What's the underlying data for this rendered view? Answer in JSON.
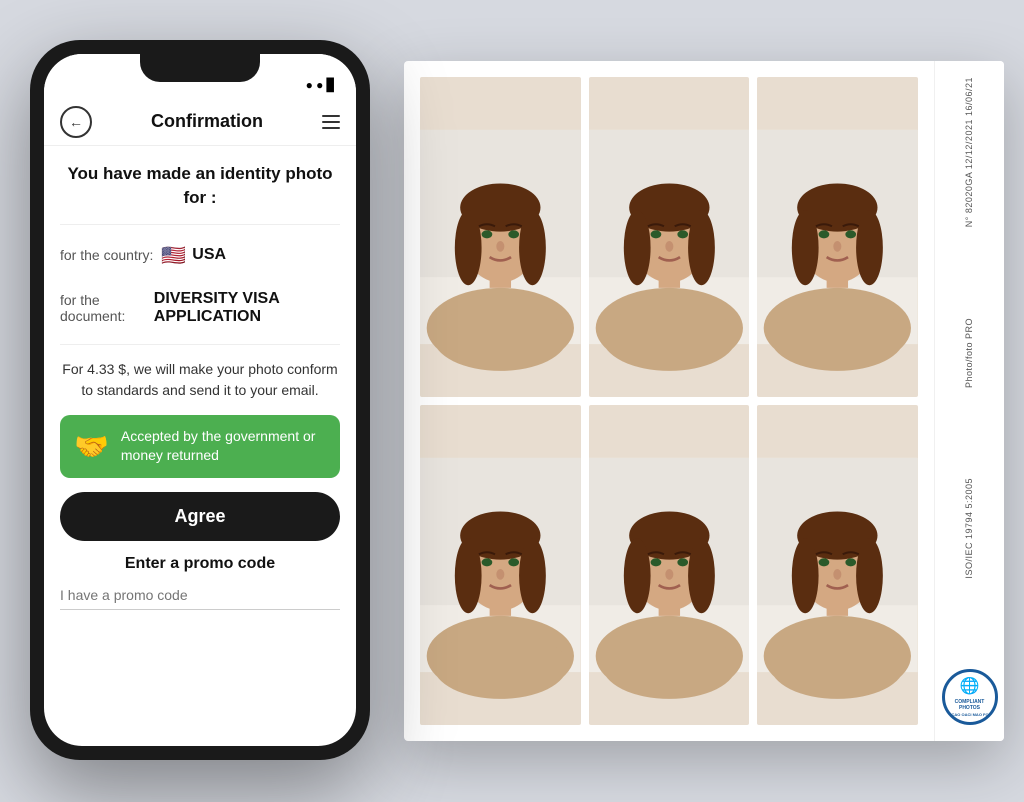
{
  "background_color": "#d6d9e0",
  "phone": {
    "nav": {
      "title": "Confirmation",
      "back_icon": "←",
      "menu_icon": "≡"
    },
    "screen": {
      "headline": "You have made an identity photo for :",
      "country_label": "for the country:",
      "country_flag": "🇺🇸",
      "country_name": "USA",
      "document_label": "for the document:",
      "document_name": "DIVERSITY VISA APPLICATION",
      "pricing_text": "For 4.33 $, we will make your photo conform to standards and send it to your email.",
      "guarantee_text": "Accepted by the government or money returned",
      "agree_button": "Agree",
      "promo_title": "Enter a promo code",
      "promo_placeholder": "I have a promo code"
    }
  },
  "photo_sheet": {
    "sidebar_text_top": "N° 82020GA\n12/12/2021\n16/06/21",
    "sidebar_text_middle": "Photo/foto PRO",
    "sidebar_text_bottom": "ISO/IEC 19794 5:2005",
    "stamp_text": "COMPLIANT PHOTOS",
    "stamp_sub": "ICAO OACI MAO\nFO"
  },
  "colors": {
    "green": "#4caf50",
    "dark": "#1a1a1a",
    "blue_stamp": "#1a5a9a",
    "photo_bg": "#c8b89a",
    "photo_skin": "#d4a882"
  }
}
